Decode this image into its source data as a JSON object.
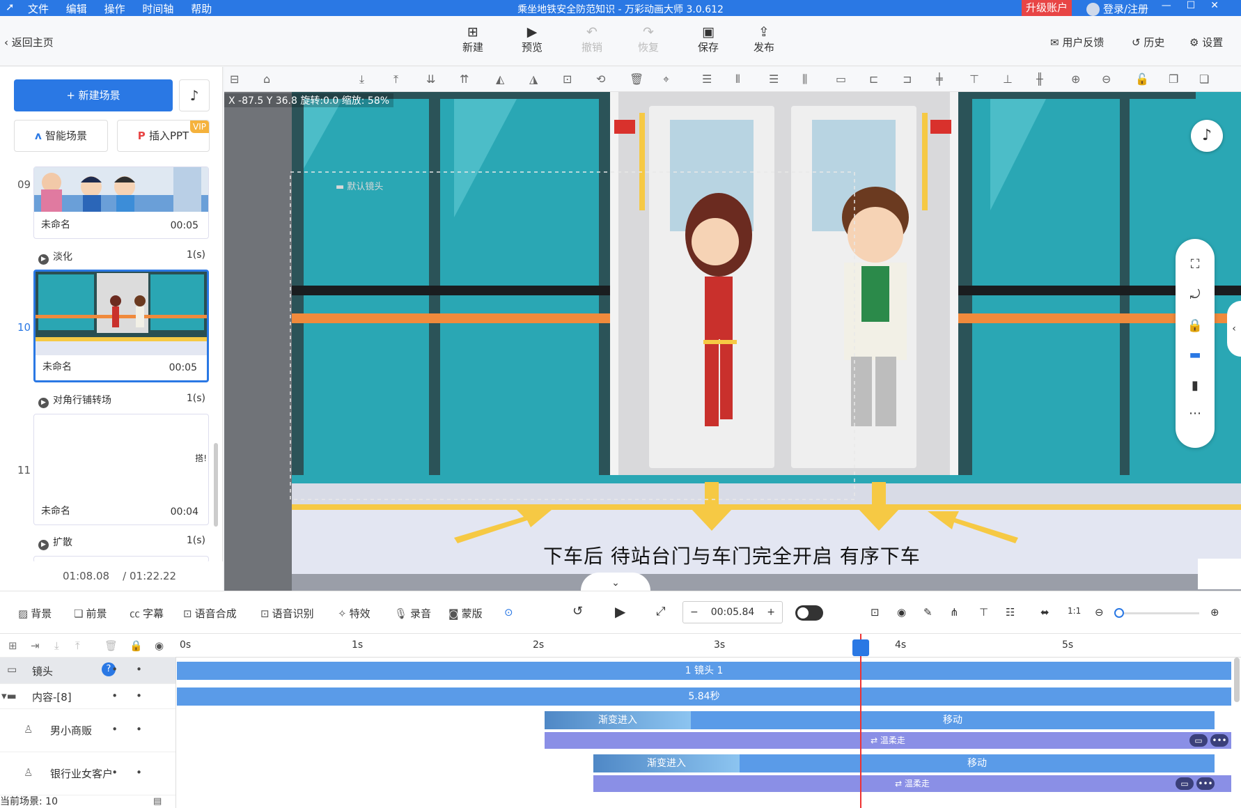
{
  "titlebar": {
    "menu": [
      "文件",
      "编辑",
      "操作",
      "时间轴",
      "帮助"
    ],
    "title": "乘坐地铁安全防范知识 - 万彩动画大师 3.0.612",
    "upgrade": "升级账户",
    "login": "登录/注册"
  },
  "toolbar": {
    "back": "返回主页",
    "new": "新建",
    "preview": "预览",
    "undo": "撤销",
    "redo": "恢复",
    "save": "保存",
    "publish": "发布",
    "feedback": "用户反馈",
    "history": "历史",
    "settings": "设置"
  },
  "left": {
    "new_scene": "+ 新建场景",
    "ai_scene": "智能场景",
    "insert_ppt": "插入PPT",
    "vip": "VIP",
    "scenes": [
      {
        "num": "09",
        "name": "未命名",
        "duration": "00:05"
      },
      {
        "num": "10",
        "name": "未命名",
        "duration": "00:05"
      },
      {
        "num": "11",
        "name": "未命名",
        "duration": "00:04",
        "partial": "搭!"
      }
    ],
    "transitions": [
      {
        "name": "淡化",
        "time": "1(s)"
      },
      {
        "name": "对角行铺转场",
        "time": "1(s)"
      },
      {
        "name": "扩散",
        "time": "1(s)"
      }
    ],
    "elapsed": "01:08.08",
    "total": "/ 01:22.22"
  },
  "stage": {
    "coords": "X -87.5 Y 36.8 旋转:0.0 缩放: 58%",
    "camera_label": "默认镜头",
    "subtitle": "下车后 待站台门与车门完全开启 有序下车"
  },
  "bottom_toolbar": {
    "items": [
      "背景",
      "前景",
      "字幕",
      "语音合成",
      "语音识别",
      "特效",
      "录音",
      "蒙版"
    ],
    "time": "00:05.84"
  },
  "timeline": {
    "ticks": [
      "0s",
      "1s",
      "2s",
      "3s",
      "4s",
      "5s"
    ],
    "tracks": [
      {
        "name": "镜头"
      },
      {
        "name": "内容-[8]"
      },
      {
        "name": "男小商贩"
      },
      {
        "name": "银行业女客户"
      }
    ],
    "camera_bar": "1 镜头 1",
    "content_bar": "5.84秒",
    "fade_in": "渐变进入",
    "move": "移动",
    "action1": "⇄ 温柔走",
    "action2": "⇄ 温柔走",
    "current_scene": "当前场景: 10"
  },
  "colors": {
    "accent": "#2a78e4",
    "upgrade": "#e84545",
    "track_bar": "#5a9be8",
    "action_bar": "#8a8fe6"
  }
}
